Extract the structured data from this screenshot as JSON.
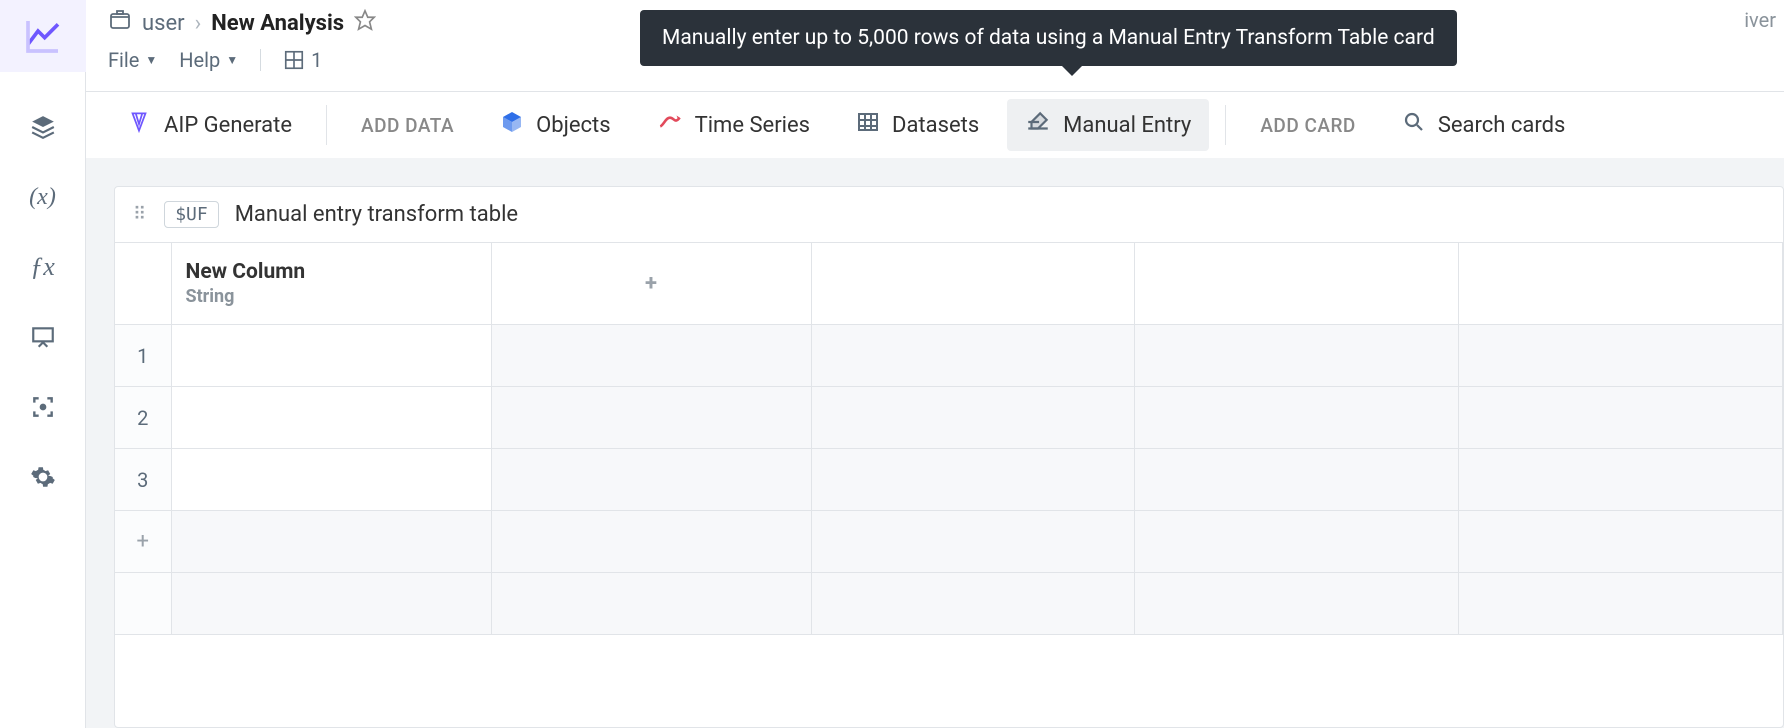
{
  "header": {
    "folder_user": "user",
    "title": "New Analysis",
    "faded_text": "iver"
  },
  "menu": {
    "file": "File",
    "help": "Help",
    "panel_count": "1"
  },
  "toolbar": {
    "aip_generate": "AIP Generate",
    "add_data": "ADD DATA",
    "objects": "Objects",
    "time_series": "Time Series",
    "datasets": "Datasets",
    "manual_entry": "Manual Entry",
    "add_card": "ADD CARD",
    "search_placeholder": "Search cards"
  },
  "tooltip": {
    "text": "Manually enter up to 5,000 rows of data using a Manual Entry Transform Table card"
  },
  "card": {
    "badge": "$UF",
    "title": "Manual entry transform table"
  },
  "table": {
    "column": {
      "name": "New Column",
      "type": "String"
    },
    "rows": [
      "1",
      "2",
      "3"
    ],
    "add_row_glyph": "+",
    "add_col_glyph": "+"
  }
}
